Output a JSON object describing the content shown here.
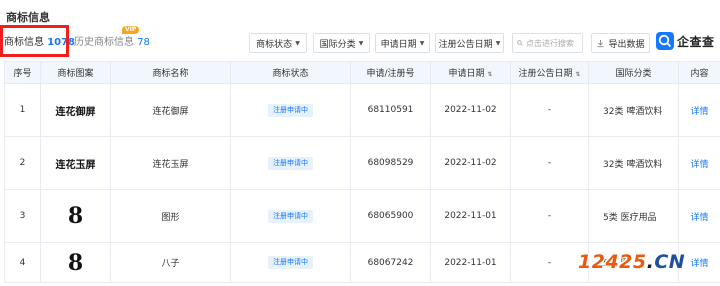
{
  "page": {
    "title": "商标信息"
  },
  "tabs": {
    "active": {
      "label": "商标信息",
      "count": "1078"
    },
    "history": {
      "label": "历史商标信息",
      "count": "78",
      "vip_badge": "VIP"
    }
  },
  "toolbar": {
    "filters": [
      {
        "label": "商标状态"
      },
      {
        "label": "国际分类"
      },
      {
        "label": "申请日期"
      },
      {
        "label": "注册公告日期"
      }
    ],
    "search_placeholder": "点击进行搜索",
    "export_label": "导出数据",
    "logo_text": "企查查"
  },
  "table": {
    "headers": [
      "序号",
      "商标图案",
      "商标名称",
      "商标状态",
      "申请/注册号",
      "申请日期",
      "注册公告日期",
      "国际分类",
      "内容"
    ],
    "rows": [
      {
        "index": "1",
        "mark": "连花御屏",
        "name": "连花御屏",
        "status": "注册申请中",
        "reg_no": "68110591",
        "apply_date": "2022-11-02",
        "pub_date": "-",
        "class": "32类 啤酒饮料",
        "action": "详情"
      },
      {
        "index": "2",
        "mark": "连花玉屏",
        "name": "连花玉屏",
        "status": "注册申请中",
        "reg_no": "68098529",
        "apply_date": "2022-11-02",
        "pub_date": "-",
        "class": "32类 啤酒饮料",
        "action": "详情"
      },
      {
        "index": "3",
        "mark": "8",
        "name": "图形",
        "status": "注册申请中",
        "reg_no": "68065900",
        "apply_date": "2022-11-01",
        "pub_date": "-",
        "class": "5类 医疗用品",
        "action": "详情"
      },
      {
        "index": "4",
        "mark": "8",
        "name": "八子",
        "status": "注册申请中",
        "reg_no": "68067242",
        "apply_date": "2022-11-01",
        "pub_date": "-",
        "class": "5类 医",
        "action": "详情"
      }
    ]
  },
  "watermark": {
    "num": "12425",
    "dot": ".",
    "cn": "CN"
  },
  "colors": {
    "accent": "#1677ff",
    "highlight_box": "#f21d1d",
    "header_bg": "#f2f7fd",
    "vip": "#f5a623"
  }
}
